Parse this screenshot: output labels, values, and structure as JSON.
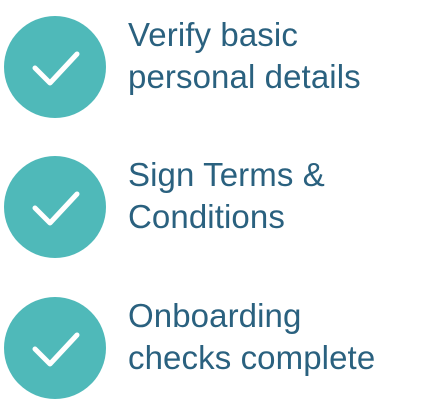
{
  "checklist": {
    "accent_color": "#4fb9b9",
    "text_color": "#2a617f",
    "items": [
      {
        "icon": "checkmark-circle-icon",
        "status": "complete",
        "label_line_1": "Verify basic",
        "label_line_2": "personal details"
      },
      {
        "icon": "checkmark-circle-icon",
        "status": "complete",
        "label_line_1": "Sign Terms &",
        "label_line_2": "Conditions"
      },
      {
        "icon": "checkmark-circle-icon",
        "status": "complete",
        "label_line_1": "Onboarding",
        "label_line_2": "checks complete"
      }
    ]
  }
}
